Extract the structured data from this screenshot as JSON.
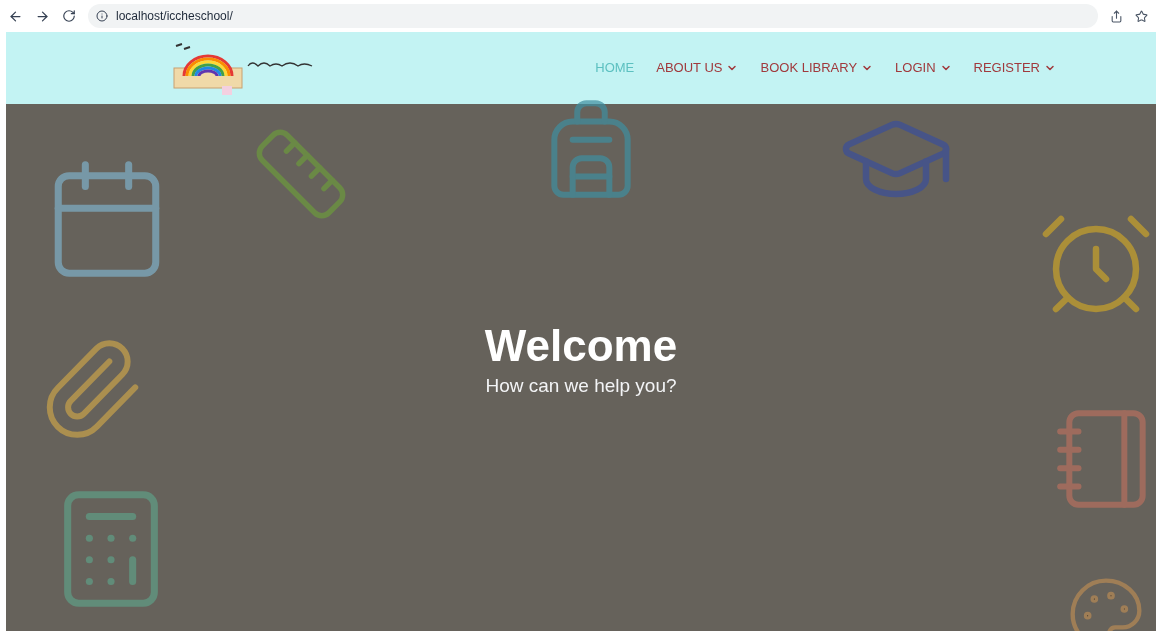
{
  "browser": {
    "url": "localhost/iccheschool/"
  },
  "nav": {
    "items": [
      {
        "label": "HOME",
        "selected": true,
        "dropdown": false
      },
      {
        "label": "ABOUT US",
        "selected": false,
        "dropdown": true
      },
      {
        "label": "BOOK LIBRARY",
        "selected": false,
        "dropdown": true
      },
      {
        "label": "LOGIN",
        "selected": false,
        "dropdown": true
      },
      {
        "label": "REGISTER",
        "selected": false,
        "dropdown": true
      }
    ]
  },
  "hero": {
    "title": "Welcome",
    "subtitle": "How can we help you?"
  }
}
